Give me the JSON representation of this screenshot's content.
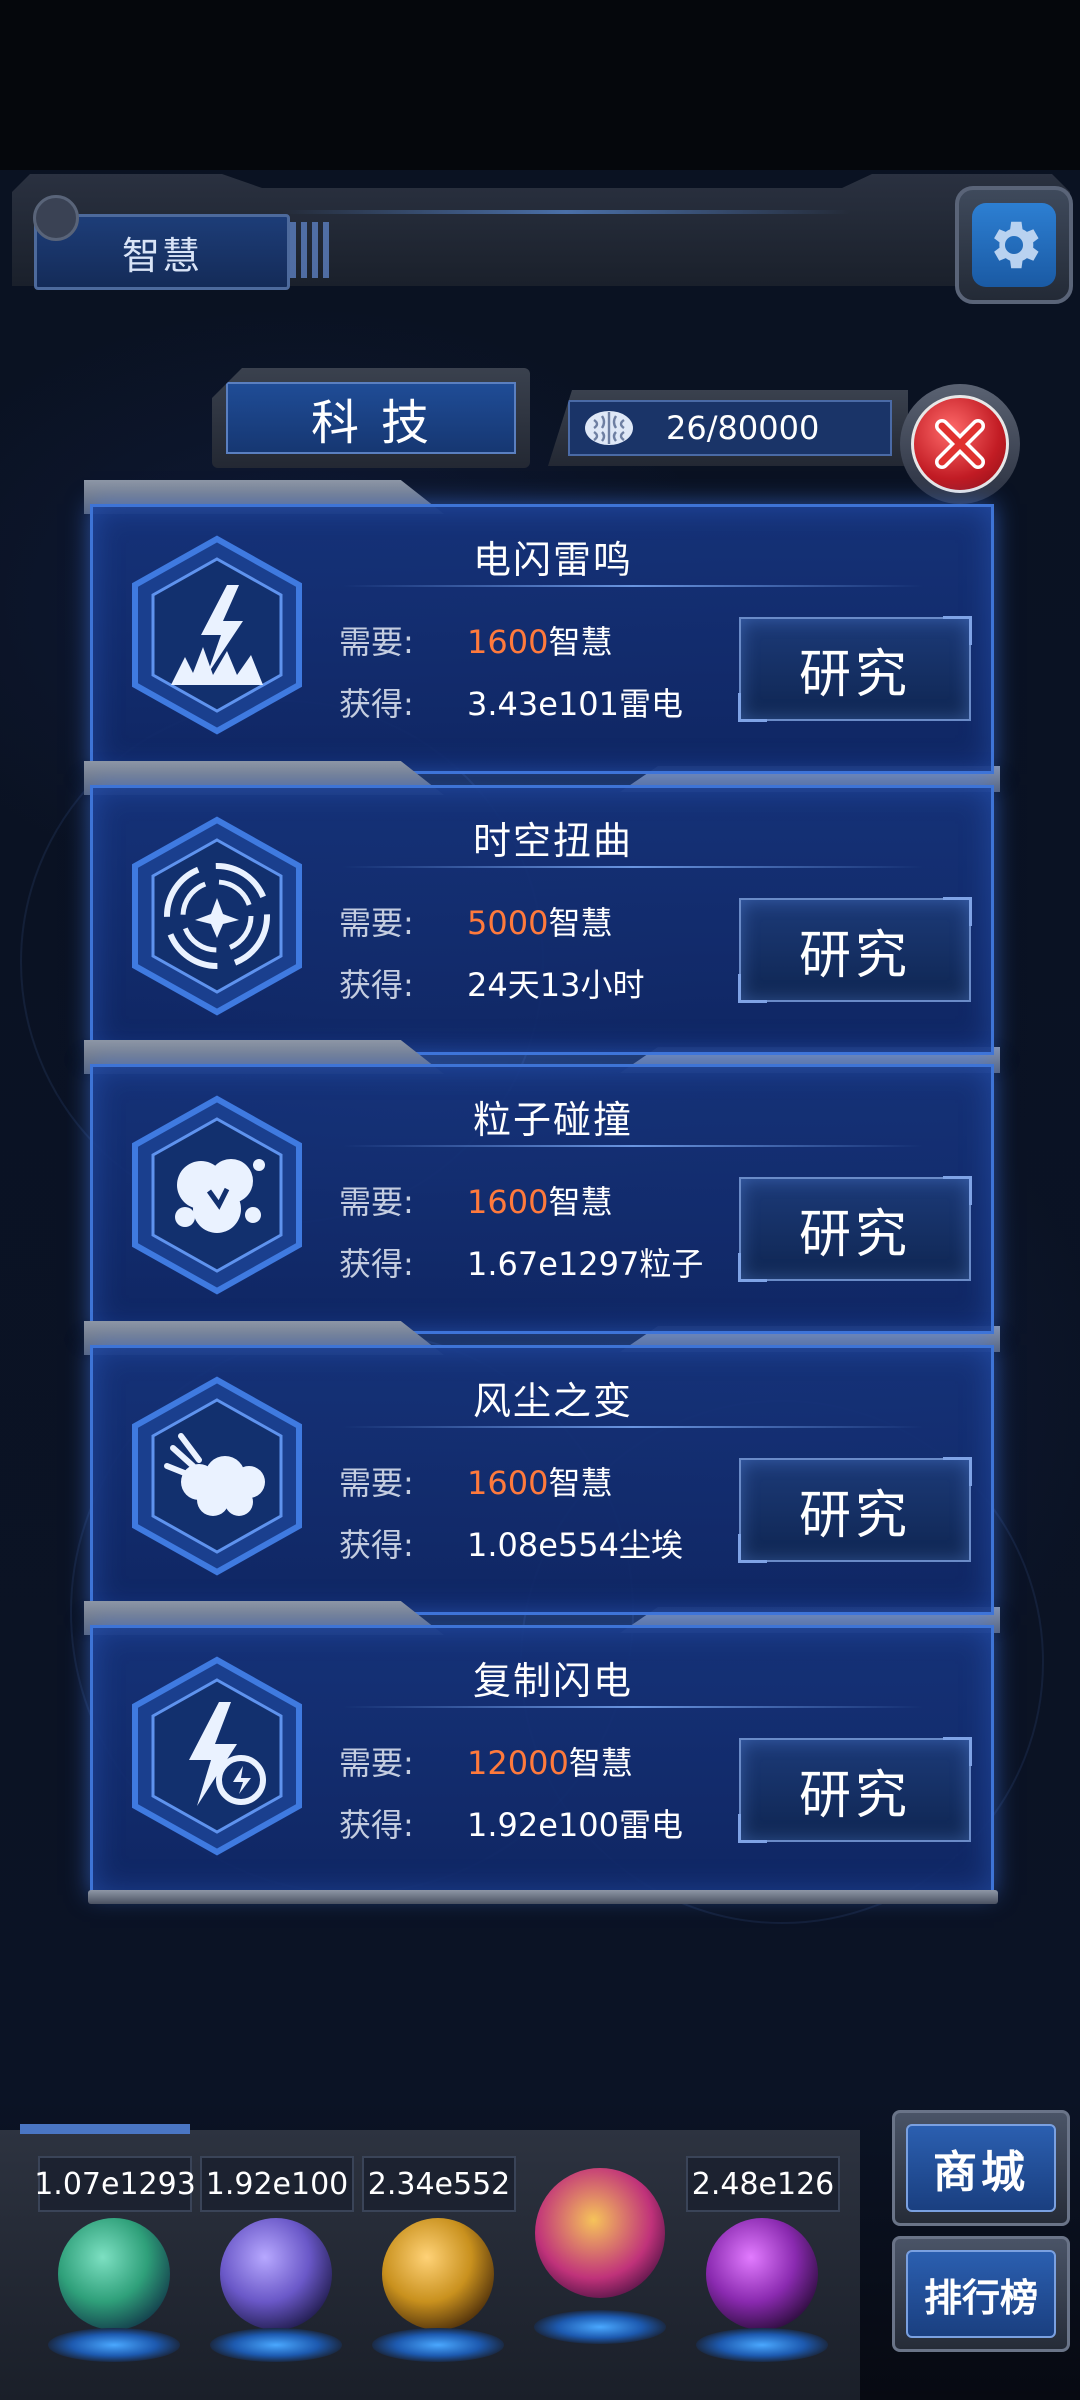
{
  "header": {
    "tab_label": "智慧"
  },
  "panel": {
    "title": "科技",
    "counter": "26/80000"
  },
  "techs": [
    {
      "name": "电闪雷鸣",
      "need_label": "需要:",
      "cost": "1600",
      "cost_unit": "智慧",
      "gain_label": "获得:",
      "gain": "3.43e101雷电",
      "button": "研究",
      "icon": "lightning-burst-icon"
    },
    {
      "name": "时空扭曲",
      "need_label": "需要:",
      "cost": "5000",
      "cost_unit": "智慧",
      "gain_label": "获得:",
      "gain": "24天13小时",
      "button": "研究",
      "icon": "vortex-icon"
    },
    {
      "name": "粒子碰撞",
      "need_label": "需要:",
      "cost": "1600",
      "cost_unit": "智慧",
      "gain_label": "获得:",
      "gain": "1.67e1297粒子",
      "button": "研究",
      "icon": "particle-collision-icon"
    },
    {
      "name": "风尘之变",
      "need_label": "需要:",
      "cost": "1600",
      "cost_unit": "智慧",
      "gain_label": "获得:",
      "gain": "1.08e554尘埃",
      "button": "研究",
      "icon": "dust-cloud-icon"
    },
    {
      "name": "复制闪电",
      "need_label": "需要:",
      "cost": "12000",
      "cost_unit": "智慧",
      "gain_label": "获得:",
      "gain": "1.92e100雷电",
      "button": "研究",
      "icon": "copy-lightning-icon"
    }
  ],
  "dock": {
    "resources": [
      {
        "value": "1.07e1293",
        "icon": "particle-orb-icon",
        "color": "#2fa07a"
      },
      {
        "value": "1.92e100",
        "icon": "lightning-orb-icon",
        "color": "#6a58c8"
      },
      {
        "value": "2.34e552",
        "icon": "dust-orb-icon",
        "color": "#c9911e"
      },
      {
        "value": "",
        "icon": "brain-orb-icon",
        "color": "#c0327a"
      },
      {
        "value": "2.48e126",
        "icon": "vortex-orb-icon",
        "color": "#8a2ab0"
      }
    ],
    "shop_label": "商城",
    "rank_label": "排行榜"
  },
  "colors": {
    "accent_blue": "#3e74d6",
    "cost_orange": "#ff7a3c",
    "close_red": "#c21c24"
  }
}
